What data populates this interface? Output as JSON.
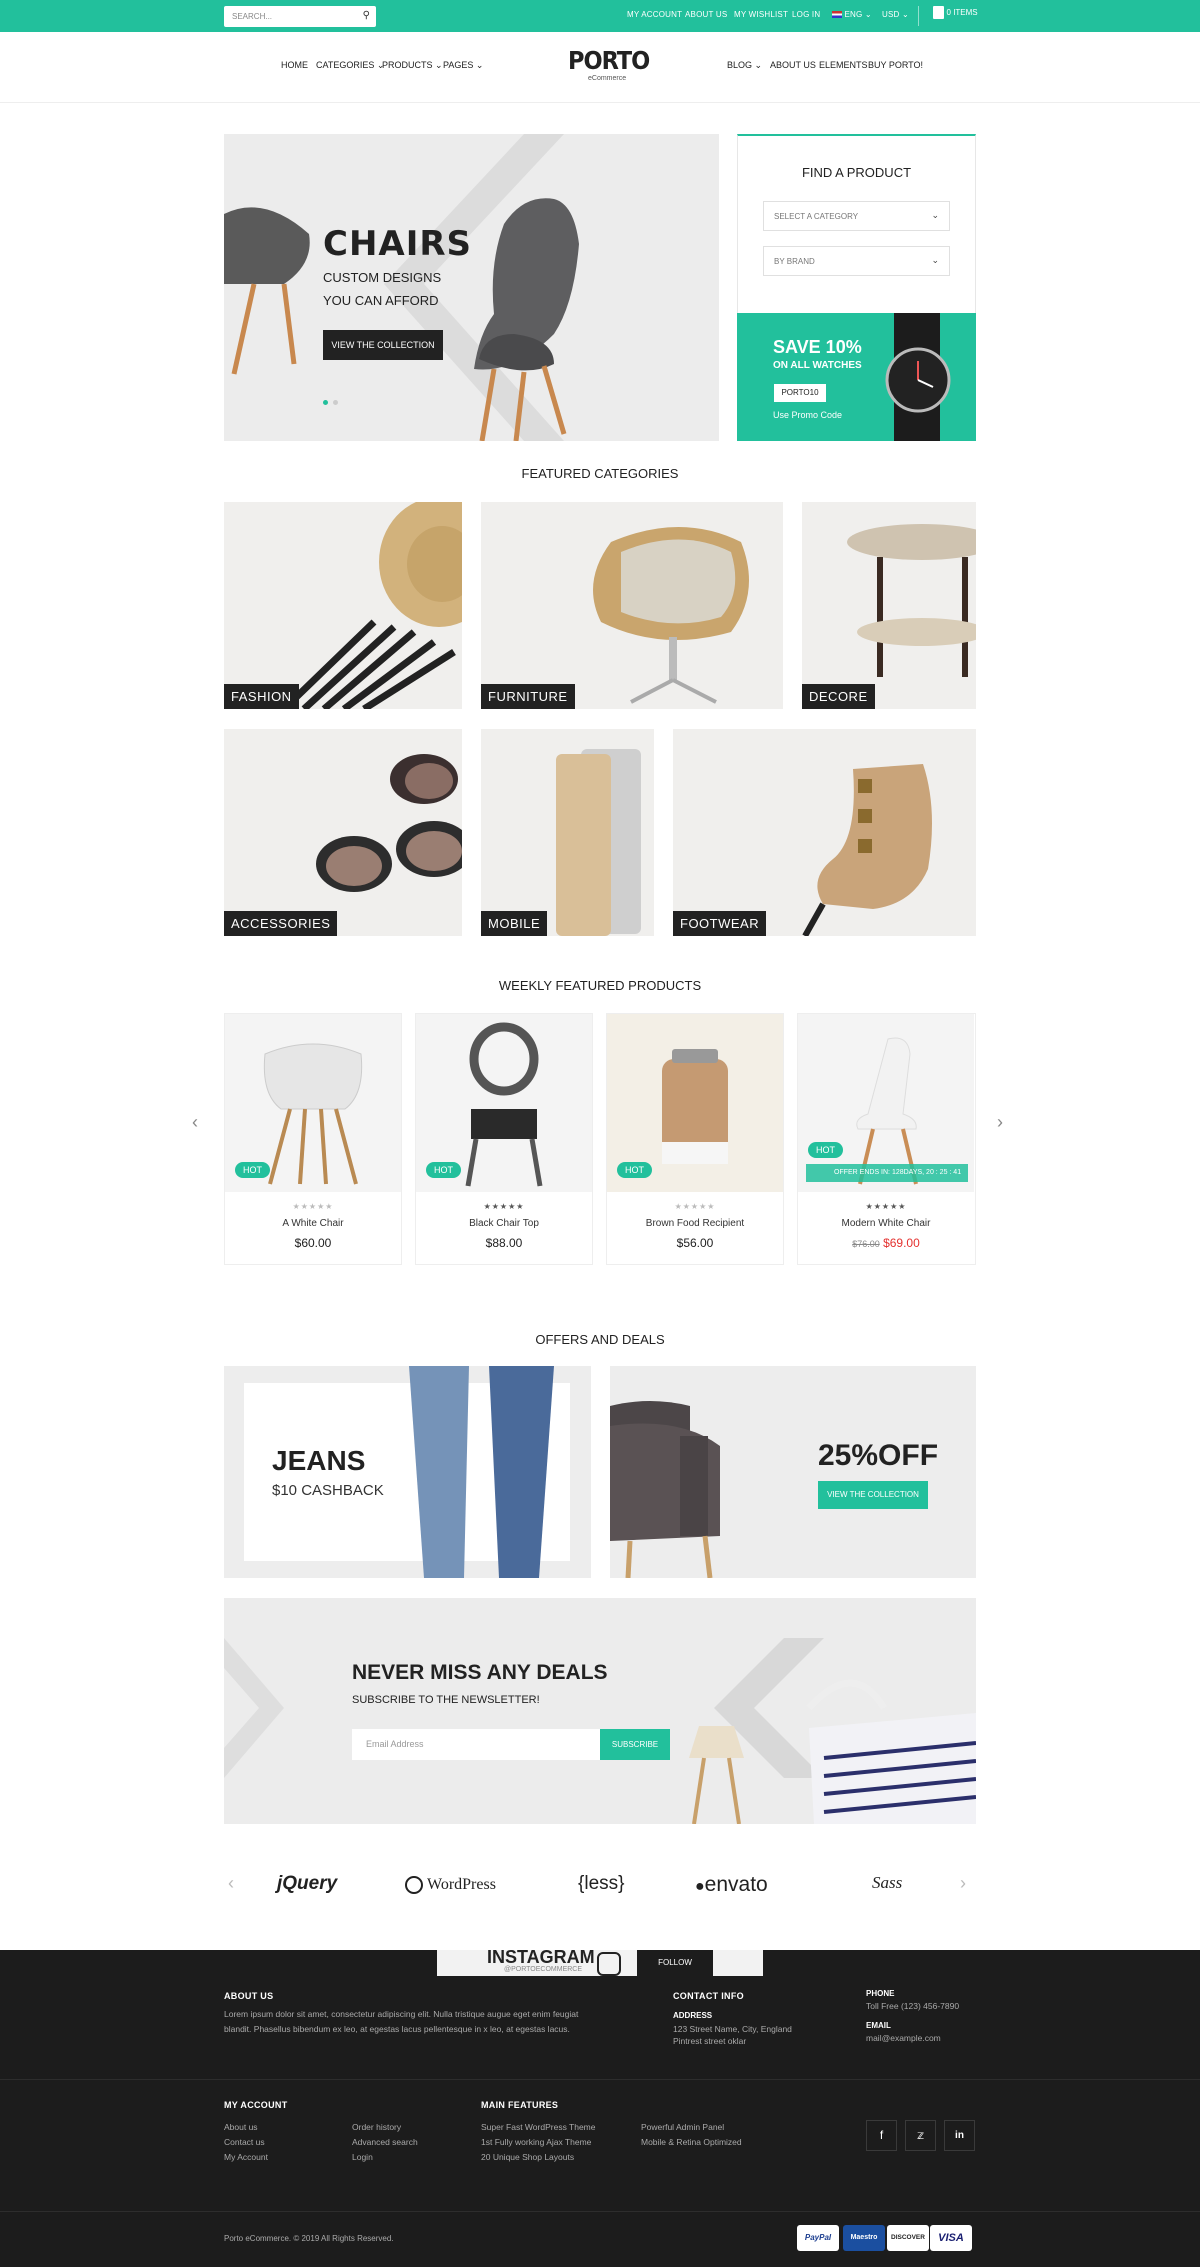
{
  "topbar": {
    "search_placeholder": "SEARCH...",
    "links": [
      "MY ACCOUNT",
      "ABOUT US",
      "MY WISHLIST",
      "LOG IN"
    ],
    "language": "ENG",
    "currency": "USD",
    "cart": "0 ITEMS"
  },
  "header": {
    "logo": "PORTO",
    "logo_sub": "eCommerce",
    "nav_left": [
      "HOME",
      "CATEGORIES",
      "PRODUCTS",
      "PAGES"
    ],
    "nav_right": [
      "BLOG",
      "ABOUT US",
      "ELEMENTS",
      "BUY PORTO!"
    ]
  },
  "hero": {
    "title": "CHAIRS",
    "sub1": "CUSTOM DESIGNS",
    "sub2": "YOU CAN AFFORD",
    "button": "VIEW THE COLLECTION"
  },
  "finder": {
    "title": "FIND A PRODUCT",
    "category_placeholder": "SELECT A CATEGORY",
    "brand_placeholder": "BY BRAND"
  },
  "promo": {
    "headline": "SAVE 10%",
    "sub": "ON ALL WATCHES",
    "code": "PORTO10",
    "note": "Use Promo Code"
  },
  "featured_categories": {
    "title": "FEATURED CATEGORIES",
    "items": [
      "FASHION",
      "FURNITURE",
      "DECORE",
      "ACCESSORIES",
      "MOBILE",
      "FOOTWEAR"
    ]
  },
  "weekly": {
    "title": "WEEKLY FEATURED PRODUCTS",
    "badge": "HOT",
    "countdown": "OFFER ENDS IN: 128DAYS, 20 : 25 : 41",
    "products": [
      {
        "name": "A White Chair",
        "price": "$60.00",
        "old_price": "",
        "stars": "★★★★★"
      },
      {
        "name": "Black Chair Top",
        "price": "$88.00",
        "old_price": "",
        "stars": "★★★★★"
      },
      {
        "name": "Brown Food Recipient",
        "price": "$56.00",
        "old_price": "",
        "stars": "★★★★★"
      },
      {
        "name": "Modern White Chair",
        "price": "$69.00",
        "old_price": "$76.00",
        "stars": "★★★★★"
      }
    ]
  },
  "offers": {
    "title": "OFFERS AND DEALS",
    "left_title": "JEANS",
    "left_sub": "$10 CASHBACK",
    "right_title": "25%OFF",
    "right_button": "VIEW THE COLLECTION"
  },
  "newsletter": {
    "title": "NEVER MISS ANY DEALS",
    "sub": "SUBSCRIBE TO THE NEWSLETTER!",
    "placeholder": "Email Address",
    "button": "SUBSCRIBE"
  },
  "brands": [
    "jQuery",
    "WordPress",
    "{less}",
    "envato",
    "Sass"
  ],
  "instagram": {
    "title": "INSTAGRAM",
    "handle": "@PORTOECOMMERCE",
    "button": "FOLLOW"
  },
  "footer": {
    "about_title": "ABOUT US",
    "about_text": "Lorem ipsum dolor sit amet, consectetur adipiscing elit. Nulla tristique augue eget enim feugiat blandit. Phasellus bibendum ex leo, at egestas lacus pellentesque in x leo, at egestas lacus.",
    "contact_title": "CONTACT INFO",
    "address_label": "ADDRESS",
    "address_1": "123 Street Name, City, England",
    "address_2": "Pintrest street oklar",
    "phone_label": "PHONE",
    "phone": "Toll Free (123) 456-7890",
    "email_label": "EMAIL",
    "email": "mail@example.com",
    "account_title": "MY ACCOUNT",
    "account_col1": [
      "About us",
      "Contact us",
      "My Account"
    ],
    "account_col2": [
      "Order history",
      "Advanced search",
      "Login"
    ],
    "features_title": "MAIN FEATURES",
    "features_col1": [
      "Super Fast WordPress Theme",
      "1st Fully working Ajax Theme",
      "20 Unique Shop Layouts"
    ],
    "features_col2": [
      "Powerful Admin Panel",
      "Mobile & Retina Optimized"
    ],
    "copyright": "Porto eCommerce. © 2019 All Rights Reserved.",
    "payments": [
      "PayPal",
      "Maestro",
      "DISCOVER",
      "VISA"
    ]
  },
  "colors": {
    "accent": "#22c09c",
    "dark": "#1c1c1c",
    "sale": "#e4312f"
  }
}
